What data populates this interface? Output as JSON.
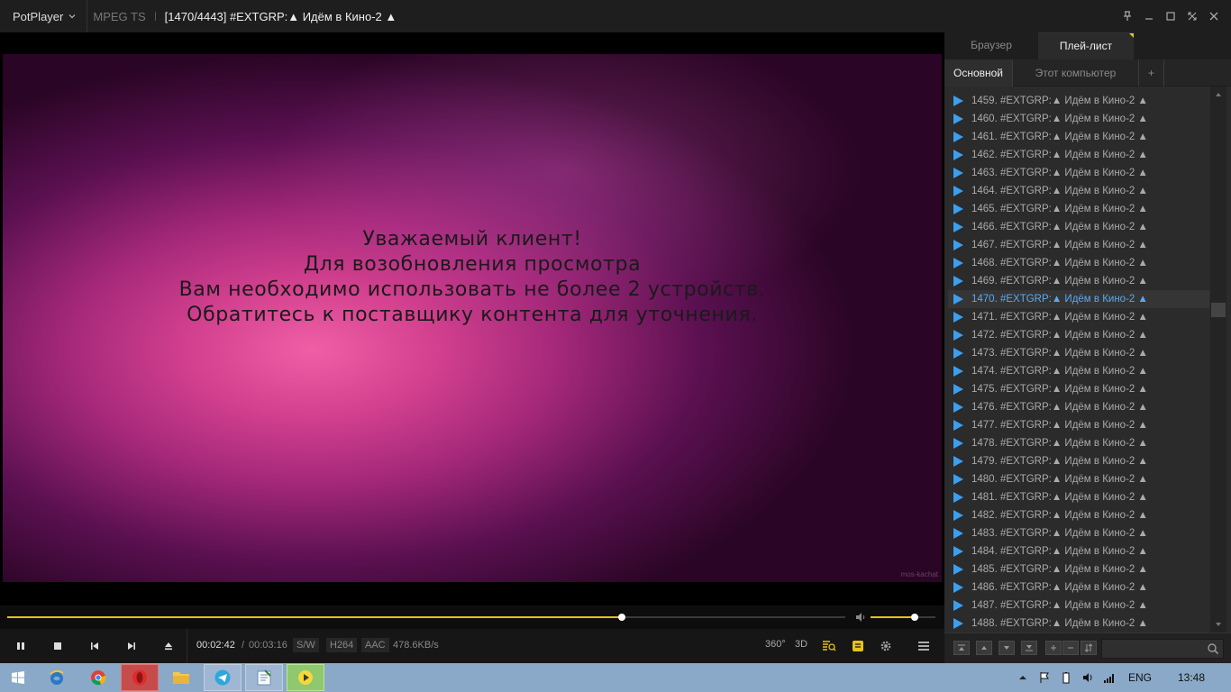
{
  "titlebar": {
    "app_name": "PotPlayer",
    "format": "MPEG TS",
    "title": "[1470/4443] #EXTGRP:▲ Идём в Кино-2 ▲"
  },
  "video": {
    "message_lines": [
      "Уважаемый клиент!",
      "Для возобновления просмотра",
      "Вам необходимо использовать не более 2 устройств.",
      "Обратитесь к поставщику контента для уточнения."
    ],
    "watermark": "mos-kachat"
  },
  "playback": {
    "position": 0.733,
    "volume": 0.68,
    "time_current": "00:02:42",
    "time_separator": "/",
    "time_total": "00:03:16",
    "tag_sw": "S/W",
    "tag_video": "H264",
    "tag_audio": "AAC",
    "bitrate": "478.6KB/s",
    "btn_360": "360°",
    "btn_3d": "3D"
  },
  "sidebar": {
    "tabs": [
      "Браузер",
      "Плей-лист"
    ],
    "subtabs": [
      "Основной",
      "Этот компьютер",
      "+"
    ],
    "items": [
      "1459. #EXTGRP:▲ Идём в Кино-2 ▲",
      "1460. #EXTGRP:▲ Идём в Кино-2 ▲",
      "1461. #EXTGRP:▲ Идём в Кино-2 ▲",
      "1462. #EXTGRP:▲ Идём в Кино-2 ▲",
      "1463. #EXTGRP:▲ Идём в Кино-2 ▲",
      "1464. #EXTGRP:▲ Идём в Кино-2 ▲",
      "1465. #EXTGRP:▲ Идём в Кино-2 ▲",
      "1466. #EXTGRP:▲ Идём в Кино-2 ▲",
      "1467. #EXTGRP:▲ Идём в Кино-2 ▲",
      "1468. #EXTGRP:▲ Идём в Кино-2 ▲",
      "1469. #EXTGRP:▲ Идём в Кино-2 ▲",
      "1470. #EXTGRP:▲ Идём в Кино-2 ▲",
      "1471. #EXTGRP:▲ Идём в Кино-2 ▲",
      "1472. #EXTGRP:▲ Идём в Кино-2 ▲",
      "1473. #EXTGRP:▲ Идём в Кино-2 ▲",
      "1474. #EXTGRP:▲ Идём в Кино-2 ▲",
      "1475. #EXTGRP:▲ Идём в Кино-2 ▲",
      "1476. #EXTGRP:▲ Идём в Кино-2 ▲",
      "1477. #EXTGRP:▲ Идём в Кино-2 ▲",
      "1478. #EXTGRP:▲ Идём в Кино-2 ▲",
      "1479. #EXTGRP:▲ Идём в Кино-2 ▲",
      "1480. #EXTGRP:▲ Идём в Кино-2 ▲",
      "1481. #EXTGRP:▲ Идём в Кино-2 ▲",
      "1482. #EXTGRP:▲ Идём в Кино-2 ▲",
      "1483. #EXTGRP:▲ Идём в Кино-2 ▲",
      "1484. #EXTGRP:▲ Идём в Кино-2 ▲",
      "1485. #EXTGRP:▲ Идём в Кино-2 ▲",
      "1486. #EXTGRP:▲ Идём в Кино-2 ▲",
      "1487. #EXTGRP:▲ Идём в Кино-2 ▲",
      "1488. #EXTGRP:▲ Идём в Кино-2 ▲"
    ],
    "current_index": 11
  },
  "taskbar": {
    "lang": "ENG",
    "clock": "13:48"
  },
  "colors": {
    "accent": "#e8c21a",
    "current_item": "#58a9f2",
    "play_icon": "#3b9ff0"
  }
}
